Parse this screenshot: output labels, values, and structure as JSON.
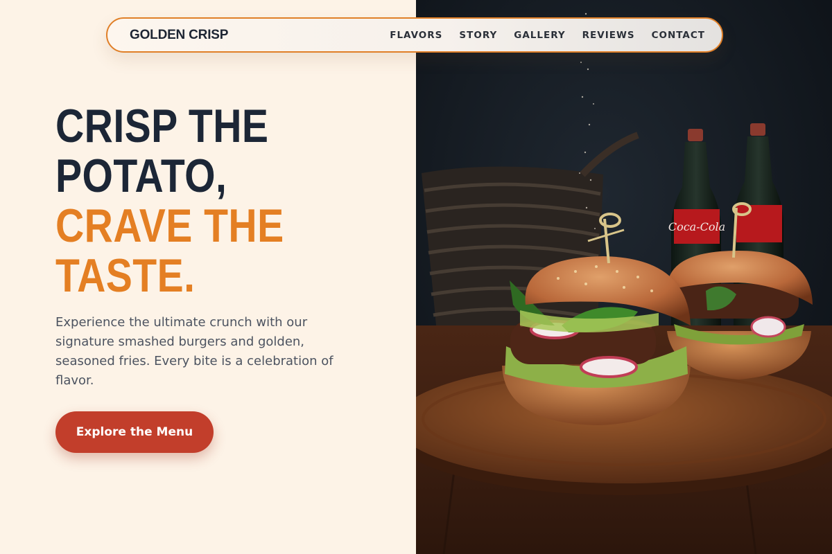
{
  "brand": {
    "name": "GOLDEN CRISP"
  },
  "nav": {
    "items": [
      {
        "label": "FLAVORS"
      },
      {
        "label": "STORY"
      },
      {
        "label": "GALLERY"
      },
      {
        "label": "REVIEWS"
      },
      {
        "label": "CONTACT"
      }
    ]
  },
  "hero": {
    "headline_line1": "CRISP THE",
    "headline_line2": "POTATO,",
    "headline_line3": "CRAVE THE",
    "headline_line4": "TASTE.",
    "description": "Experience the ultimate crunch with our signature smashed burgers and golden, seasoned fries. Every bite is a celebration of flavor.",
    "cta_label": "Explore the Menu"
  },
  "image": {
    "bottle_label": "Coca-Cola"
  },
  "colors": {
    "accent": "#e47f23",
    "dark": "#1c2636",
    "cta": "#c23e2b",
    "background": "#fdf3e7"
  }
}
